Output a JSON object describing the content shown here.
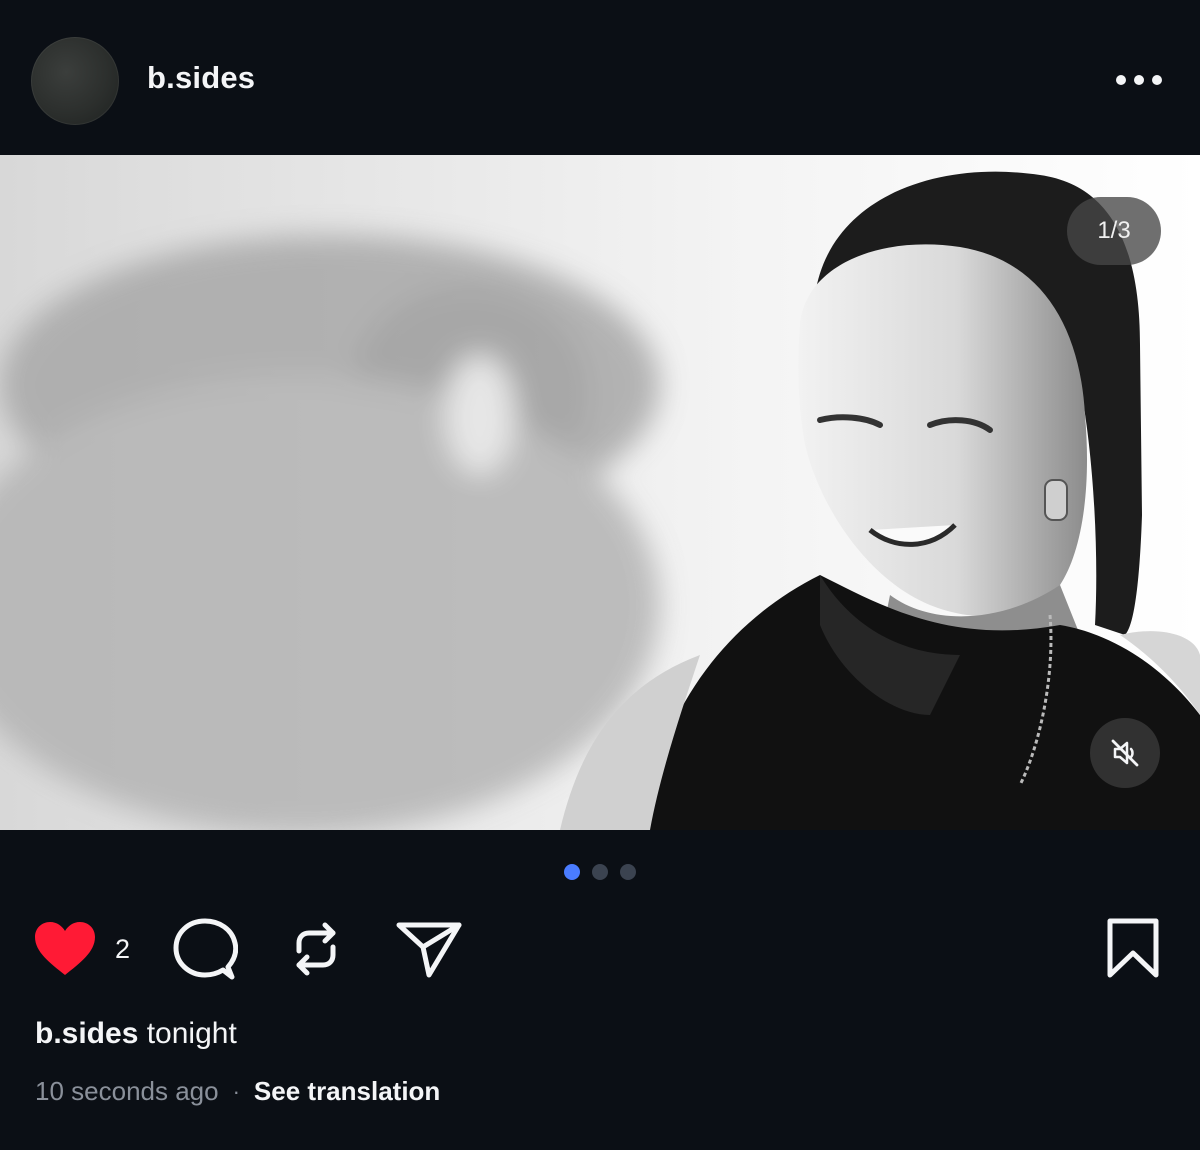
{
  "post": {
    "username": "b.sides",
    "counter": "1/3",
    "slide_count": 3,
    "active_slide": 1,
    "like_count": "2",
    "liked": true,
    "caption_user": "b.sides",
    "caption_text": "tonight",
    "timestamp": "10 seconds ago",
    "separator": "·",
    "translate_label": "See translation"
  },
  "icons": {
    "more": "more-horizontal-icon",
    "mute": "speaker-muted-icon",
    "like": "heart-icon",
    "comment": "speech-bubble-icon",
    "repost": "repost-arrows-icon",
    "share": "paper-plane-icon",
    "save": "bookmark-icon"
  },
  "colors": {
    "background": "#0b0f15",
    "like_red": "#ff1a35",
    "active_dot": "#4a7cff",
    "inactive_dot": "#3b4350",
    "secondary_text": "#8a909a"
  }
}
